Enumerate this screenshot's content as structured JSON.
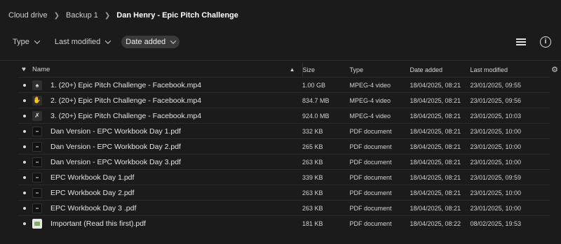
{
  "breadcrumb": [
    "Cloud drive",
    "Backup 1",
    "Dan Henry - Epic Pitch Challenge"
  ],
  "filters": [
    {
      "label": "Type",
      "active": false
    },
    {
      "label": "Last modified",
      "active": false
    },
    {
      "label": "Date added",
      "active": true
    }
  ],
  "table": {
    "headers": {
      "name": "Name",
      "size": "Size",
      "type": "Type",
      "date_added": "Date added",
      "last_modified": "Last modified"
    },
    "rows": [
      {
        "icon": "video-thumbnail-icon",
        "glyph": "♠",
        "name": "1. (20+) Epic Pitch Challenge - Facebook.mp4",
        "size": "1.00 GB",
        "type": "MPEG-4 video",
        "date_added": "18/04/2025, 08:21",
        "last_modified": "23/01/2025, 09:55"
      },
      {
        "icon": "video-thumbnail-icon",
        "glyph": "✋",
        "name": "2. (20+) Epic Pitch Challenge - Facebook.mp4",
        "size": "834.7 MB",
        "type": "MPEG-4 video",
        "date_added": "18/04/2025, 08:21",
        "last_modified": "23/01/2025, 09:56"
      },
      {
        "icon": "video-thumbnail-icon",
        "glyph": "✗",
        "name": "3. (20+) Epic Pitch Challenge - Facebook.mp4",
        "size": "924.0 MB",
        "type": "MPEG-4 video",
        "date_added": "18/04/2025, 08:21",
        "last_modified": "23/01/2025, 10:03"
      },
      {
        "icon": "pdf-thumbnail-icon",
        "glyph": "",
        "name": "Dan Version - EPC Workbook Day 1.pdf",
        "size": "332 KB",
        "type": "PDF document",
        "date_added": "18/04/2025, 08:21",
        "last_modified": "23/01/2025, 10:00"
      },
      {
        "icon": "pdf-thumbnail-icon",
        "glyph": "",
        "name": "Dan Version - EPC Workbook Day 2.pdf",
        "size": "265 KB",
        "type": "PDF document",
        "date_added": "18/04/2025, 08:21",
        "last_modified": "23/01/2025, 10:00"
      },
      {
        "icon": "pdf-thumbnail-icon",
        "glyph": "",
        "name": "Dan Version - EPC Workbook Day 3.pdf",
        "size": "263 KB",
        "type": "PDF document",
        "date_added": "18/04/2025, 08:21",
        "last_modified": "23/01/2025, 10:00"
      },
      {
        "icon": "pdf-thumbnail-icon",
        "glyph": "",
        "name": "EPC Workbook Day 1.pdf",
        "size": "339 KB",
        "type": "PDF document",
        "date_added": "18/04/2025, 08:21",
        "last_modified": "23/01/2025, 09:59"
      },
      {
        "icon": "pdf-thumbnail-icon",
        "glyph": "",
        "name": "EPC Workbook Day 2.pdf",
        "size": "263 KB",
        "type": "PDF document",
        "date_added": "18/04/2025, 08:21",
        "last_modified": "23/01/2025, 10:00"
      },
      {
        "icon": "pdf-thumbnail-icon",
        "glyph": "",
        "name": "EPC Workbook Day 3 .pdf",
        "size": "263 KB",
        "type": "PDF document",
        "date_added": "18/04/2025, 08:21",
        "last_modified": "23/01/2025, 10:00"
      },
      {
        "icon": "document-thumbnail-icon",
        "glyph": "",
        "name": "Important (Read this first).pdf",
        "size": "181 KB",
        "type": "PDF document",
        "date_added": "18/04/2025, 08:22",
        "last_modified": "08/02/2025, 19:53"
      }
    ]
  },
  "colors": {
    "background": "#1b1b1b",
    "text": "#e6e6e6",
    "active_filter": "#3a3a3a"
  }
}
